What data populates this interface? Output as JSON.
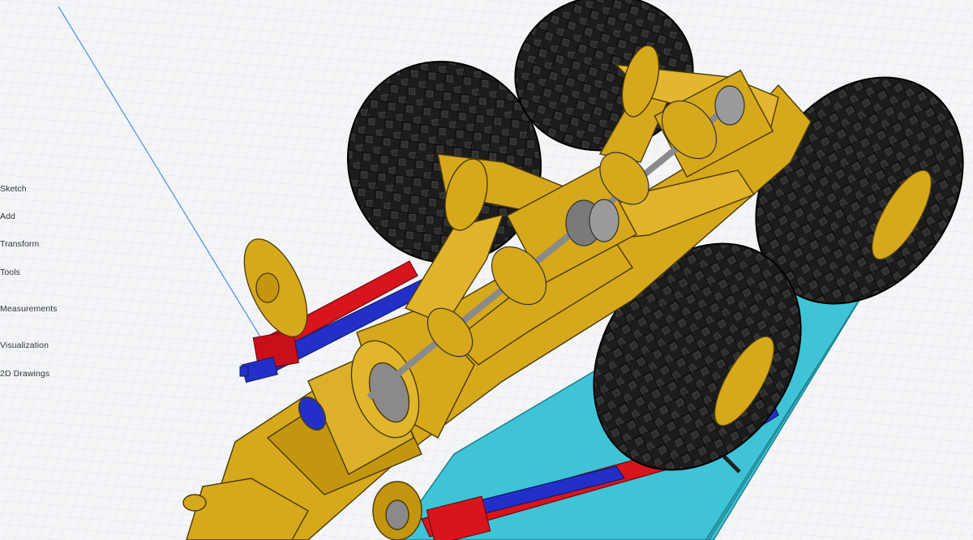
{
  "sidebar": {
    "items": [
      {
        "id": "sketch",
        "label": "Sketch"
      },
      {
        "id": "add",
        "label": "Add"
      },
      {
        "id": "transform",
        "label": "Transform"
      },
      {
        "id": "tools",
        "label": "Tools"
      },
      {
        "id": "measurements",
        "label": "Measurements"
      },
      {
        "id": "visualization",
        "label": "Visualization"
      },
      {
        "id": "2d-drawings",
        "label": "2D Drawings"
      }
    ]
  },
  "colors": {
    "background": "#f2f3f5",
    "grid_line": "#d9dde2",
    "axis_line": "#4a90e2",
    "chassis_gold": "#d6a81c",
    "tire_black": "#1c1c1c",
    "base_plate_cyan": "#3ec4d6",
    "rod_red": "#d8141c",
    "rod_blue": "#2330c8",
    "axle_gray": "#9a9a9a",
    "accent_blue": "#1a84e6"
  },
  "icons": {
    "primary_action": "primary-action-button"
  }
}
